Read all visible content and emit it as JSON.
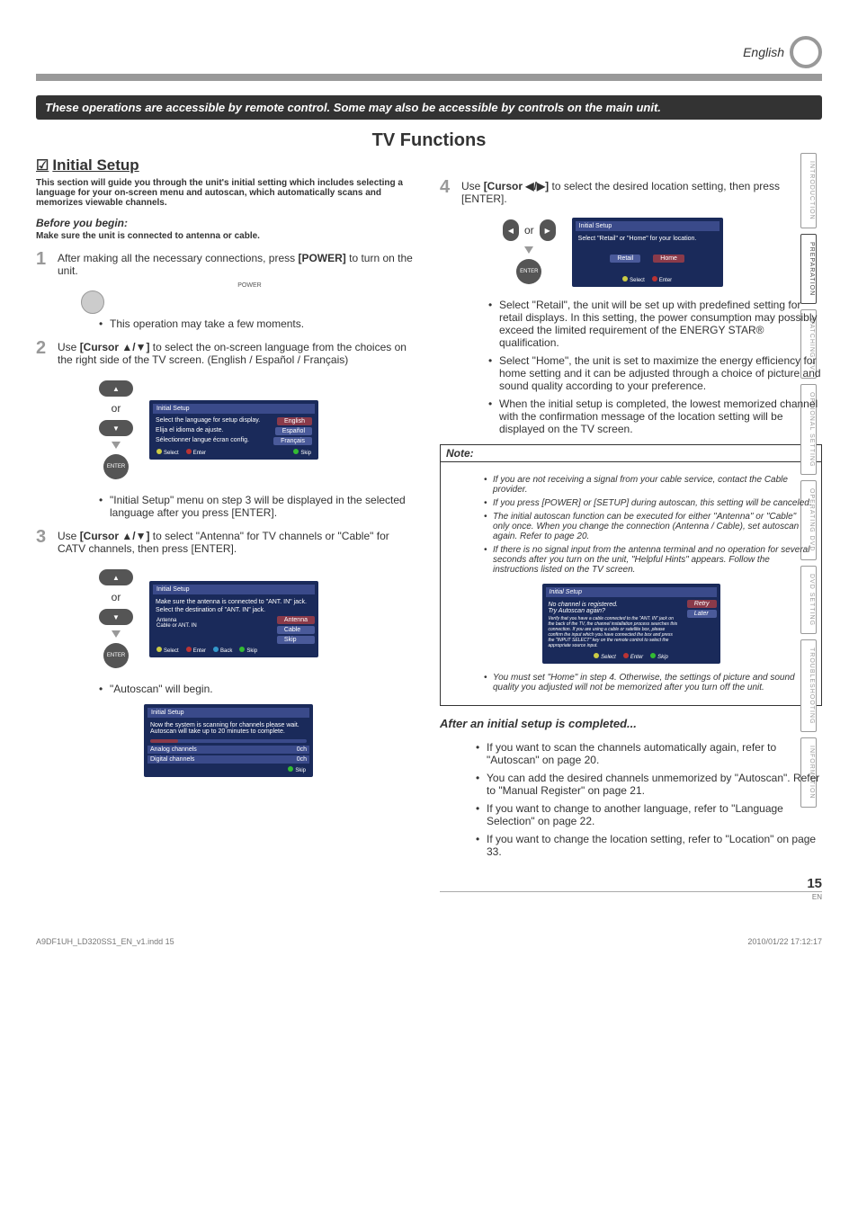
{
  "lang_label": "English",
  "ops_bar": "These operations are accessible by remote control. Some may also be accessible by controls on the main unit.",
  "tv_functions": "TV Functions",
  "initial_setup": "Initial Setup",
  "intro": "This section will guide you through the unit's initial setting which includes selecting a language for your on-screen menu and autoscan, which automatically scans and memorizes viewable channels.",
  "before": "Before you begin:",
  "before_sub": "Make sure the unit is connected to antenna or cable.",
  "side_tabs": [
    "INTRODUCTION",
    "PREPARATION",
    "WATCHING TV",
    "OPTIONAL SETTING",
    "OPERATING DVD",
    "DVD SETTING",
    "TROUBLESHOOTING",
    "INFORMATION"
  ],
  "steps": {
    "s1": {
      "n": "1",
      "txt_a": "After making all the necessary connections, press ",
      "key": "[POWER]",
      "txt_b": " to turn on the unit."
    },
    "s1_bul": "This operation may take a few moments.",
    "s2": {
      "n": "2",
      "txt_a": "Use ",
      "key": "[Cursor ▲/▼]",
      "txt_b": " to select the on-screen language from the choices on the right side of the TV screen. (English / Español / Français)"
    },
    "s2_bul": "\"Initial Setup\" menu on step 3 will be displayed in the selected language after you press [ENTER].",
    "s3": {
      "n": "3",
      "txt_a": "Use ",
      "key": "[Cursor ▲/▼]",
      "txt_b": " to select \"Antenna\" for TV channels or \"Cable\" for CATV channels, then press [ENTER]."
    },
    "s3_bul": "\"Autoscan\" will begin.",
    "s4": {
      "n": "4",
      "txt_a": "Use ",
      "key": "[Cursor ◀/▶]",
      "txt_b": " to select the desired location setting, then press [ENTER]."
    }
  },
  "or": "or",
  "pow": "POWER",
  "enter": "ENTER",
  "menu2": {
    "title": "Initial Setup",
    "rows": [
      {
        "l": "Select the language for setup display.",
        "r": "English"
      },
      {
        "l": "Elija el idioma de ajuste.",
        "r": "Español"
      },
      {
        "l": "Sélectionner langue écran config.",
        "r": "Français"
      }
    ],
    "foot": [
      "Select",
      "Enter",
      "Skip"
    ]
  },
  "menu3": {
    "title": "Initial Setup",
    "rows": [
      "Make sure the antenna is connected to \"ANT. IN\" jack.",
      "Select the destination of \"ANT. IN\" jack."
    ],
    "opts": [
      "Antenna",
      "Cable",
      "Skip"
    ],
    "diag": [
      "Antenna",
      "Cable",
      "or",
      "ANT. IN"
    ],
    "foot": [
      "Select",
      "Enter",
      "Back",
      "Skip"
    ]
  },
  "menu_scan": {
    "title": "Initial Setup",
    "msg": "Now the system is scanning for channels please wait. Autoscan will take up to 20 minutes to complete.",
    "rows": [
      {
        "l": "Analog channels",
        "r": "0ch"
      },
      {
        "l": "Digital channels",
        "r": "0ch"
      }
    ],
    "foot": [
      "Skip"
    ]
  },
  "menu4": {
    "title": "Initial Setup",
    "msg": "Select \"Retail\" or \"Home\" for your location.",
    "opts": [
      "Retail",
      "Home"
    ],
    "foot": [
      "Select",
      "Enter"
    ]
  },
  "s4_bul": [
    "Select \"Retail\", the unit will be set up with predefined setting for retail displays. In this setting, the power consumption may possibly exceed the limited requirement of the ENERGY STAR® qualification.",
    "Select \"Home\", the unit is set to maximize the energy efficiency for home setting and it can be adjusted through a choice of picture and sound quality according to your preference.",
    "When the initial setup is completed, the lowest memorized channel with the confirmation message of the location setting will be displayed on the TV screen."
  ],
  "note_hdr": "Note:",
  "notes": [
    "If you are not receiving a signal from your cable service, contact the Cable provider.",
    "If you press [POWER] or [SETUP] during autoscan, this setting will be canceled.",
    "The initial autoscan function can be executed for either \"Antenna\" or \"Cable\" only once. When you change the connection (Antenna / Cable), set autoscan again. Refer to page 20.",
    "If there is no signal input from the antenna terminal and no operation for several seconds after you turn on the unit, \"Helpful Hints\" appears. Follow the instructions listed on the TV screen."
  ],
  "note_panel": {
    "title": "Initial Setup",
    "lines": [
      "No channel is registered.",
      "Try Autoscan again?",
      "Verify that you have a cable connected to the \"ANT. IN\" jack on the back of the TV, the channel installation process searches this connection. If you are using a cable or satellite box, please confirm the input which you have connected the box and press the \"INPUT SELECT\" key on the remote control to select the appropriate source input."
    ],
    "opts": [
      "Retry",
      "Later"
    ],
    "foot": [
      "Select",
      "Enter",
      "Skip"
    ]
  },
  "note_trail": "You must set \"Home\" in step 4. Otherwise, the settings of picture and sound quality you adjusted will not be memorized after you turn off the unit.",
  "after_h": "After an initial setup is completed...",
  "after": [
    "If you want to scan the channels automatically again, refer to \"Autoscan\" on page 20.",
    "You can add the desired channels unmemorized by \"Autoscan\". Refer to \"Manual Register\" on page 21.",
    "If you want to change to another language, refer to \"Language Selection\" on page 22.",
    "If you want to change the location setting, refer to \"Location\" on page 33."
  ],
  "page_num": "15",
  "page_en": "EN",
  "footer_l": "A9DF1UH_LD320SS1_EN_v1.indd   15",
  "footer_r": "2010/01/22   17:12:17"
}
